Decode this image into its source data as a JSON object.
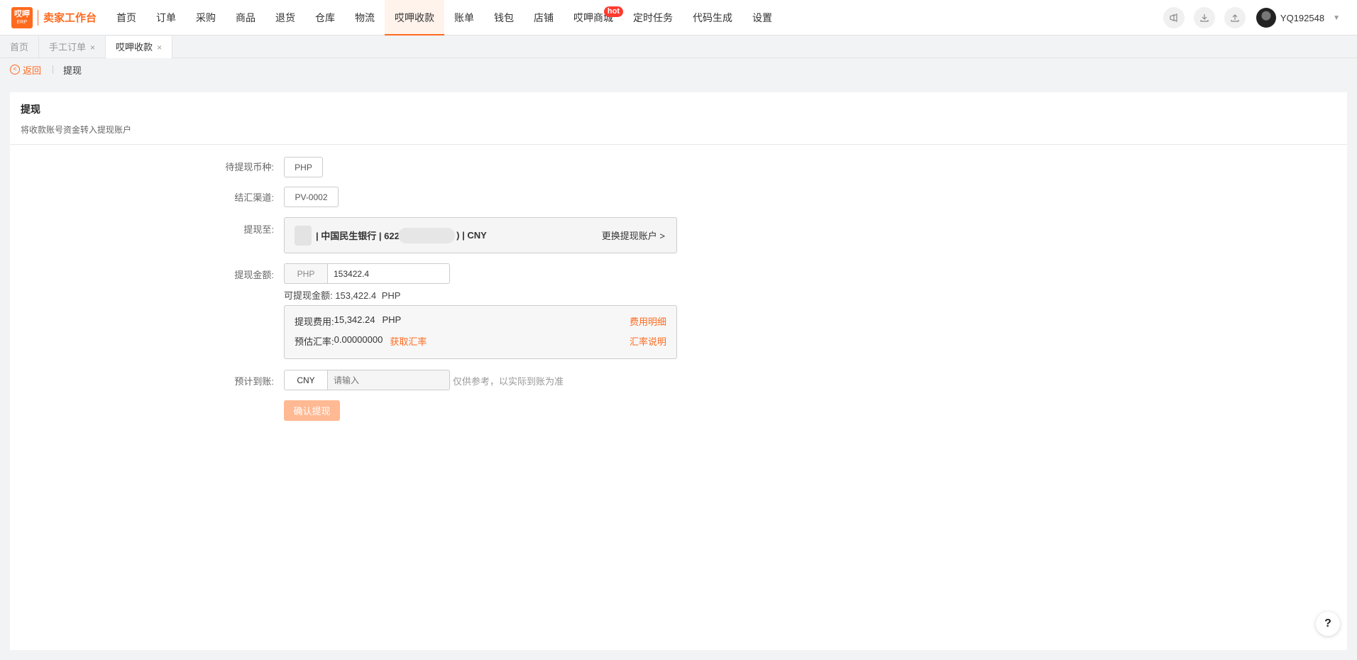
{
  "logo": {
    "mark_top": "哎呷",
    "mark_bottom": "ERP",
    "title": "卖家工作台"
  },
  "nav": [
    {
      "label": "首页"
    },
    {
      "label": "订单"
    },
    {
      "label": "采购"
    },
    {
      "label": "商品"
    },
    {
      "label": "退货"
    },
    {
      "label": "仓库"
    },
    {
      "label": "物流"
    },
    {
      "label": "哎呷收款"
    },
    {
      "label": "账单"
    },
    {
      "label": "钱包"
    },
    {
      "label": "店铺"
    },
    {
      "label": "哎呷商城",
      "badge": "hot"
    },
    {
      "label": "定时任务"
    },
    {
      "label": "代码生成"
    },
    {
      "label": "设置"
    }
  ],
  "user": {
    "name": "YQ192548"
  },
  "tabs": [
    {
      "label": "首页"
    },
    {
      "label": "手工订单",
      "close": "×"
    },
    {
      "label": "哎呷收款",
      "close": "×"
    }
  ],
  "breadcrumb": {
    "back": "返回",
    "current": "提现"
  },
  "panel": {
    "title": "提现",
    "subtitle": "将收款账号资金转入提现账户"
  },
  "form": {
    "currency_label": "待提现币种:",
    "currency_value": "PHP",
    "channel_label": "结汇渠道:",
    "channel_value": "PV-0002",
    "to_label": "提现至:",
    "account_bank": "| 中国民生银行 | 622(",
    "account_tail": ") | CNY",
    "change_account": "更换提现账户 >",
    "amount_label": "提现金额:",
    "amount_currency": "PHP",
    "amount_value": "153422.4",
    "available_label": "可提现金额:",
    "available_value": "153,422.4",
    "available_currency": "PHP",
    "fee_label": "提现费用:",
    "fee_value": "15,342.24",
    "fee_currency": "PHP",
    "fee_detail_link": "费用明细",
    "rate_label": "预估汇率:",
    "rate_value": "0.00000000",
    "get_rate_link": "获取汇率",
    "rate_note_link": "汇率说明",
    "estimate_label": "预计到账:",
    "estimate_currency": "CNY",
    "estimate_placeholder": "请输入",
    "estimate_note": "仅供参考，以实际到账为准",
    "confirm_button": "确认提现"
  },
  "help": {
    "label": "?"
  },
  "colors": {
    "accent": "#ff6a1f",
    "confirm_disabled": "#ffb993",
    "hot_badge": "#ff3b30"
  }
}
